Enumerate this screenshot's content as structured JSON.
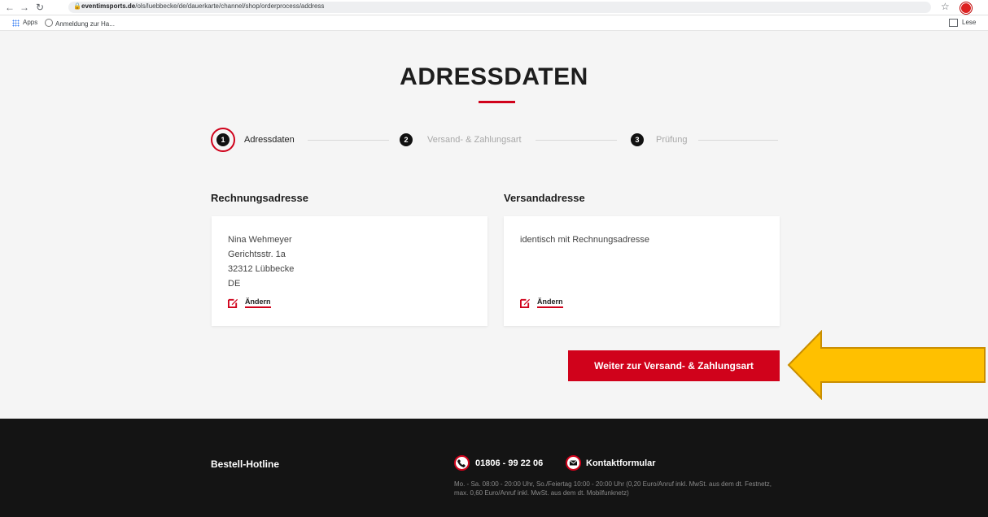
{
  "browser": {
    "url_host": "eventimsports.de",
    "url_path": "/ols/luebbecke/de/dauerkarte/channel/shop/orderprocess/address",
    "bookmarks": [
      "Apps",
      "Anmeldung zur Ha..."
    ],
    "reader_label": "Lese"
  },
  "page": {
    "title": "ADRESSDATEN"
  },
  "steps": [
    {
      "number": "1",
      "label": "Adressdaten"
    },
    {
      "number": "2",
      "label": "Versand- & Zahlungsart"
    },
    {
      "number": "3",
      "label": "Prüfung"
    }
  ],
  "billing": {
    "heading": "Rechnungsadresse",
    "lines": [
      "Nina Wehmeyer",
      "Gerichtsstr. 1a",
      "32312 Lübbecke",
      "DE"
    ],
    "edit_label": "Ändern"
  },
  "shipping": {
    "heading": "Versandadresse",
    "text": "identisch mit Rechnungsadresse",
    "edit_label": "Ändern"
  },
  "cta_label": "Weiter zur Versand- & Zahlungsart",
  "footer": {
    "heading": "Bestell-Hotline",
    "phone": "01806 - 99 22 06",
    "contact": "Kontaktformular",
    "note": "Mo. - Sa. 08:00 - 20:00 Uhr, So./Feiertag 10:00 - 20:00 Uhr (0,20 Euro/Anruf inkl. MwSt. aus dem dt. Festnetz, max. 0,60 Euro/Anruf inkl. MwSt. aus dem dt. Mobilfunknetz)"
  },
  "colors": {
    "accent": "#d0021b",
    "arrow": "#ffc000",
    "footer_bg": "#141414"
  }
}
